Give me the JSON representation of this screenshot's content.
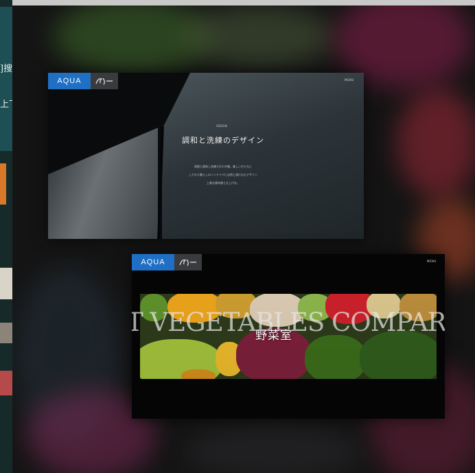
{
  "slide1": {
    "brand": "AQUA",
    "menu_label": "MENU",
    "small_label": "DESIGN",
    "title": "調和と洗練のデザイン",
    "body": [
      "周囲と調和し洗練された外観。美しいかたちに",
      "こだわり暮らしのインテリアに自然と溶け込むデザイン",
      "上質な素材感と仕上げを。"
    ]
  },
  "slide2": {
    "brand": "AQUA",
    "menu_label": "MENU",
    "heading_en": "T VEGETABLES COMPART",
    "heading_jp": "野菜室"
  },
  "left_window": {
    "glyphs": [
      "]搜",
      "上下"
    ]
  },
  "colors": {
    "aqua_blue": "#1f6fc4",
    "background": "#0c0c0d"
  }
}
